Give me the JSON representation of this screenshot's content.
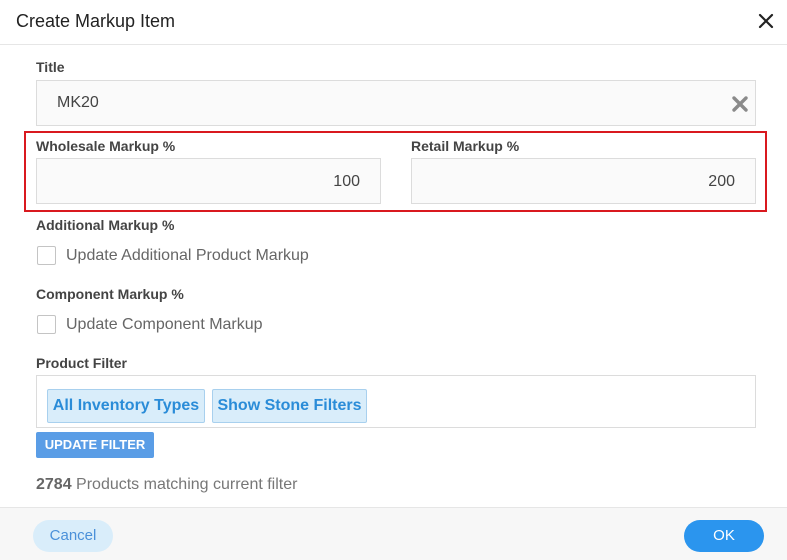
{
  "dialog": {
    "title": "Create Markup Item",
    "close_icon": "close-icon"
  },
  "title_field": {
    "label": "Title",
    "value": "MK20",
    "clear_icon": "clear-icon"
  },
  "markups": {
    "wholesale": {
      "label": "Wholesale Markup %",
      "value": "100"
    },
    "retail": {
      "label": "Retail Markup %",
      "value": "200"
    },
    "highlight_color": "#d9191f"
  },
  "additional_markup": {
    "label": "Additional Markup %",
    "checkbox_label": "Update Additional Product Markup",
    "checked": false
  },
  "component_markup": {
    "label": "Component Markup %",
    "checkbox_label": "Update Component Markup",
    "checked": false
  },
  "product_filter": {
    "label": "Product Filter",
    "chips": [
      "All Inventory Types",
      "Show Stone Filters"
    ],
    "update_button": "UPDATE FILTER"
  },
  "match_summary": {
    "count": "2784",
    "text": " Products matching current filter"
  },
  "footer": {
    "cancel_label": "Cancel",
    "ok_label": "OK"
  },
  "colors": {
    "accent": "#2b95ee",
    "chip_bg": "#d9edfa",
    "chip_text": "#2a8cd8"
  }
}
